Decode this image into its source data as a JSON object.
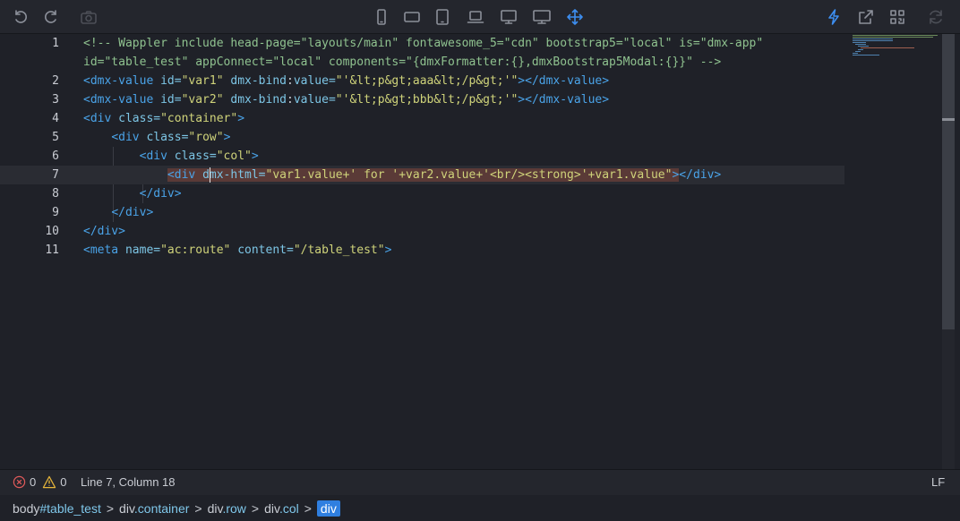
{
  "toolbar": {
    "icons": [
      "undo-icon",
      "redo-icon",
      "camera-icon",
      "phone-portrait-icon",
      "phone-landscape-icon",
      "tablet-portrait-icon",
      "laptop-icon",
      "desktop-icon",
      "monitor-icon",
      "move-icon",
      "lightning-icon",
      "share-icon",
      "qrcode-icon",
      "refresh-icon"
    ]
  },
  "editor": {
    "lines": [
      {
        "no": "1",
        "parts": [
          {
            "c": "c",
            "t": "<!-- Wappler include head-page=\"layouts/main\" fontawesome_5=\"cdn\" bootstrap5=\"local\" is=\"dmx-app\""
          }
        ]
      },
      {
        "no": "",
        "parts": [
          {
            "c": "c",
            "t": "id=\"table_test\" appConnect=\"local\" components=\"{dmxFormatter:{},dmxBootstrap5Modal:{}}\" -->"
          }
        ]
      },
      {
        "no": "2",
        "parts": [
          {
            "c": "t",
            "t": "<dmx-value "
          },
          {
            "c": "a",
            "t": "id="
          },
          {
            "c": "s",
            "t": "\"var1\" "
          },
          {
            "c": "a",
            "t": "dmx-bind"
          },
          {
            "c": "p",
            "t": ":"
          },
          {
            "c": "a",
            "t": "value="
          },
          {
            "c": "s",
            "t": "\"'&lt;p&gt;aaa&lt;/p&gt;'\""
          },
          {
            "c": "t",
            "t": "></dmx-value>"
          }
        ]
      },
      {
        "no": "3",
        "parts": [
          {
            "c": "t",
            "t": "<dmx-value "
          },
          {
            "c": "a",
            "t": "id="
          },
          {
            "c": "s",
            "t": "\"var2\" "
          },
          {
            "c": "a",
            "t": "dmx-bind"
          },
          {
            "c": "p",
            "t": ":"
          },
          {
            "c": "a",
            "t": "value="
          },
          {
            "c": "s",
            "t": "\"'&lt;p&gt;bbb&lt;/p&gt;'\""
          },
          {
            "c": "t",
            "t": "></dmx-value>"
          }
        ]
      },
      {
        "no": "4",
        "parts": [
          {
            "c": "t",
            "t": "<div "
          },
          {
            "c": "a",
            "t": "class="
          },
          {
            "c": "s",
            "t": "\"container\""
          },
          {
            "c": "t",
            "t": ">"
          }
        ]
      },
      {
        "no": "5",
        "parts": [
          {
            "c": "p",
            "t": "    "
          },
          {
            "c": "t",
            "t": "<div "
          },
          {
            "c": "a",
            "t": "class="
          },
          {
            "c": "s",
            "t": "\"row\""
          },
          {
            "c": "t",
            "t": ">"
          }
        ]
      },
      {
        "no": "6",
        "parts": [
          {
            "c": "p",
            "t": "        "
          },
          {
            "c": "t",
            "t": "<div "
          },
          {
            "c": "a",
            "t": "class="
          },
          {
            "c": "s",
            "t": "\"col\""
          },
          {
            "c": "t",
            "t": ">"
          }
        ]
      },
      {
        "no": "7",
        "current": true,
        "parts": [
          {
            "c": "p",
            "t": "            "
          },
          {
            "c": "t hl",
            "t": "<div "
          },
          {
            "c": "a hl",
            "t": "dmx-html="
          },
          {
            "c": "s hl",
            "t": "\"var1.value+' for '+var2.value+'<br/><strong>'+var1.value\""
          },
          {
            "c": "t hl",
            "t": ">"
          },
          {
            "c": "t",
            "t": "</div>"
          }
        ]
      },
      {
        "no": "8",
        "parts": [
          {
            "c": "p",
            "t": "        "
          },
          {
            "c": "t",
            "t": "</div>"
          }
        ]
      },
      {
        "no": "9",
        "parts": [
          {
            "c": "p",
            "t": "    "
          },
          {
            "c": "t",
            "t": "</div>"
          }
        ]
      },
      {
        "no": "10",
        "parts": [
          {
            "c": "t",
            "t": "</div>"
          }
        ]
      },
      {
        "no": "11",
        "parts": [
          {
            "c": "t",
            "t": "<meta "
          },
          {
            "c": "a",
            "t": "name="
          },
          {
            "c": "s",
            "t": "\"ac:route\" "
          },
          {
            "c": "a",
            "t": "content="
          },
          {
            "c": "s",
            "t": "\"/table_test\""
          },
          {
            "c": "t",
            "t": ">"
          }
        ]
      }
    ]
  },
  "status": {
    "errors": "0",
    "warnings": "0",
    "position": "Line 7, Column 18",
    "eol": "LF"
  },
  "breadcrumb": {
    "body_tag": "body",
    "body_id": "#table_test",
    "container_tag": "div",
    "container_class": ".container",
    "row_tag": "div",
    "row_class": ".row",
    "col_tag": "div",
    "col_class": ".col",
    "active": "div",
    "sep": ">"
  }
}
